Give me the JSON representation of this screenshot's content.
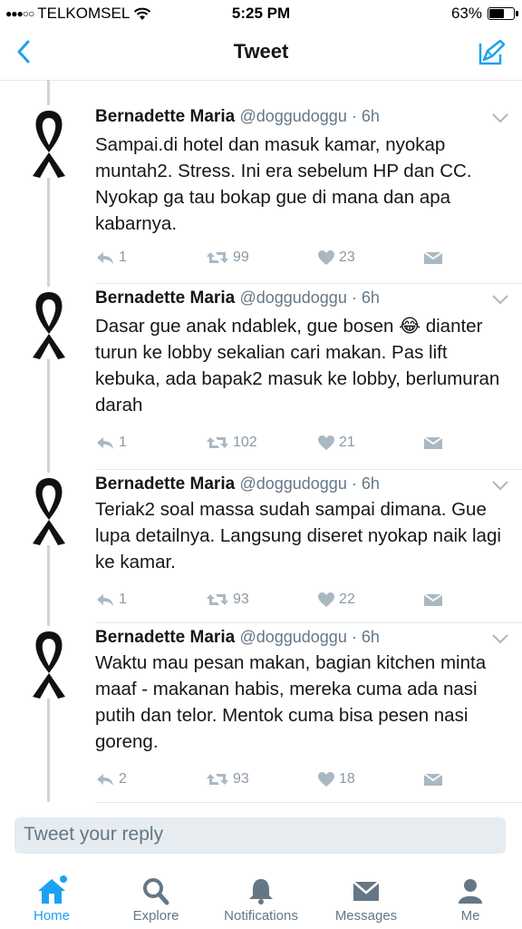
{
  "status_bar": {
    "signal": "●●●○○",
    "carrier": "TELKOMSEL",
    "time": "5:25 PM",
    "battery": "63%",
    "battery_level": 0.63
  },
  "nav": {
    "title": "Tweet"
  },
  "tweets": [
    {
      "name": "Bernadette Maria",
      "handle": "@doggudoggu · 6h",
      "text": "Sampai.di hotel dan masuk kamar, nyokap muntah2. Stress. Ini era sebelum HP dan CC. Nyokap ga tau bokap gue di mana dan apa kabarnya.",
      "replies": "1",
      "retweets": "99",
      "likes": "23"
    },
    {
      "name": "Bernadette Maria",
      "handle": "@doggudoggu · 6h",
      "text": "Dasar gue anak ndablek, gue bosen 😂 dianter turun ke lobby sekalian cari makan. Pas lift kebuka, ada bapak2 masuk ke lobby, berlumuran darah",
      "replies": "1",
      "retweets": "102",
      "likes": "21"
    },
    {
      "name": "Bernadette Maria",
      "handle": "@doggudoggu · 6h",
      "text": "Teriak2 soal massa sudah sampai dimana. Gue lupa detailnya. Langsung diseret nyokap naik lagi ke kamar.",
      "replies": "1",
      "retweets": "93",
      "likes": "22"
    },
    {
      "name": "Bernadette Maria",
      "handle": "@doggudoggu · 6h",
      "text": "Waktu mau pesan makan, bagian kitchen minta maaf - makanan habis, mereka cuma ada nasi putih dan telor. Mentok cuma bisa pesen nasi goreng.",
      "replies": "2",
      "retweets": "93",
      "likes": "18"
    }
  ],
  "reply": {
    "placeholder": "Tweet your reply"
  },
  "tabs": {
    "home": "Home",
    "explore": "Explore",
    "notifications": "Notifications",
    "messages": "Messages",
    "me": "Me"
  },
  "colors": {
    "accent": "#1da1f2",
    "muted": "#8899a6"
  }
}
